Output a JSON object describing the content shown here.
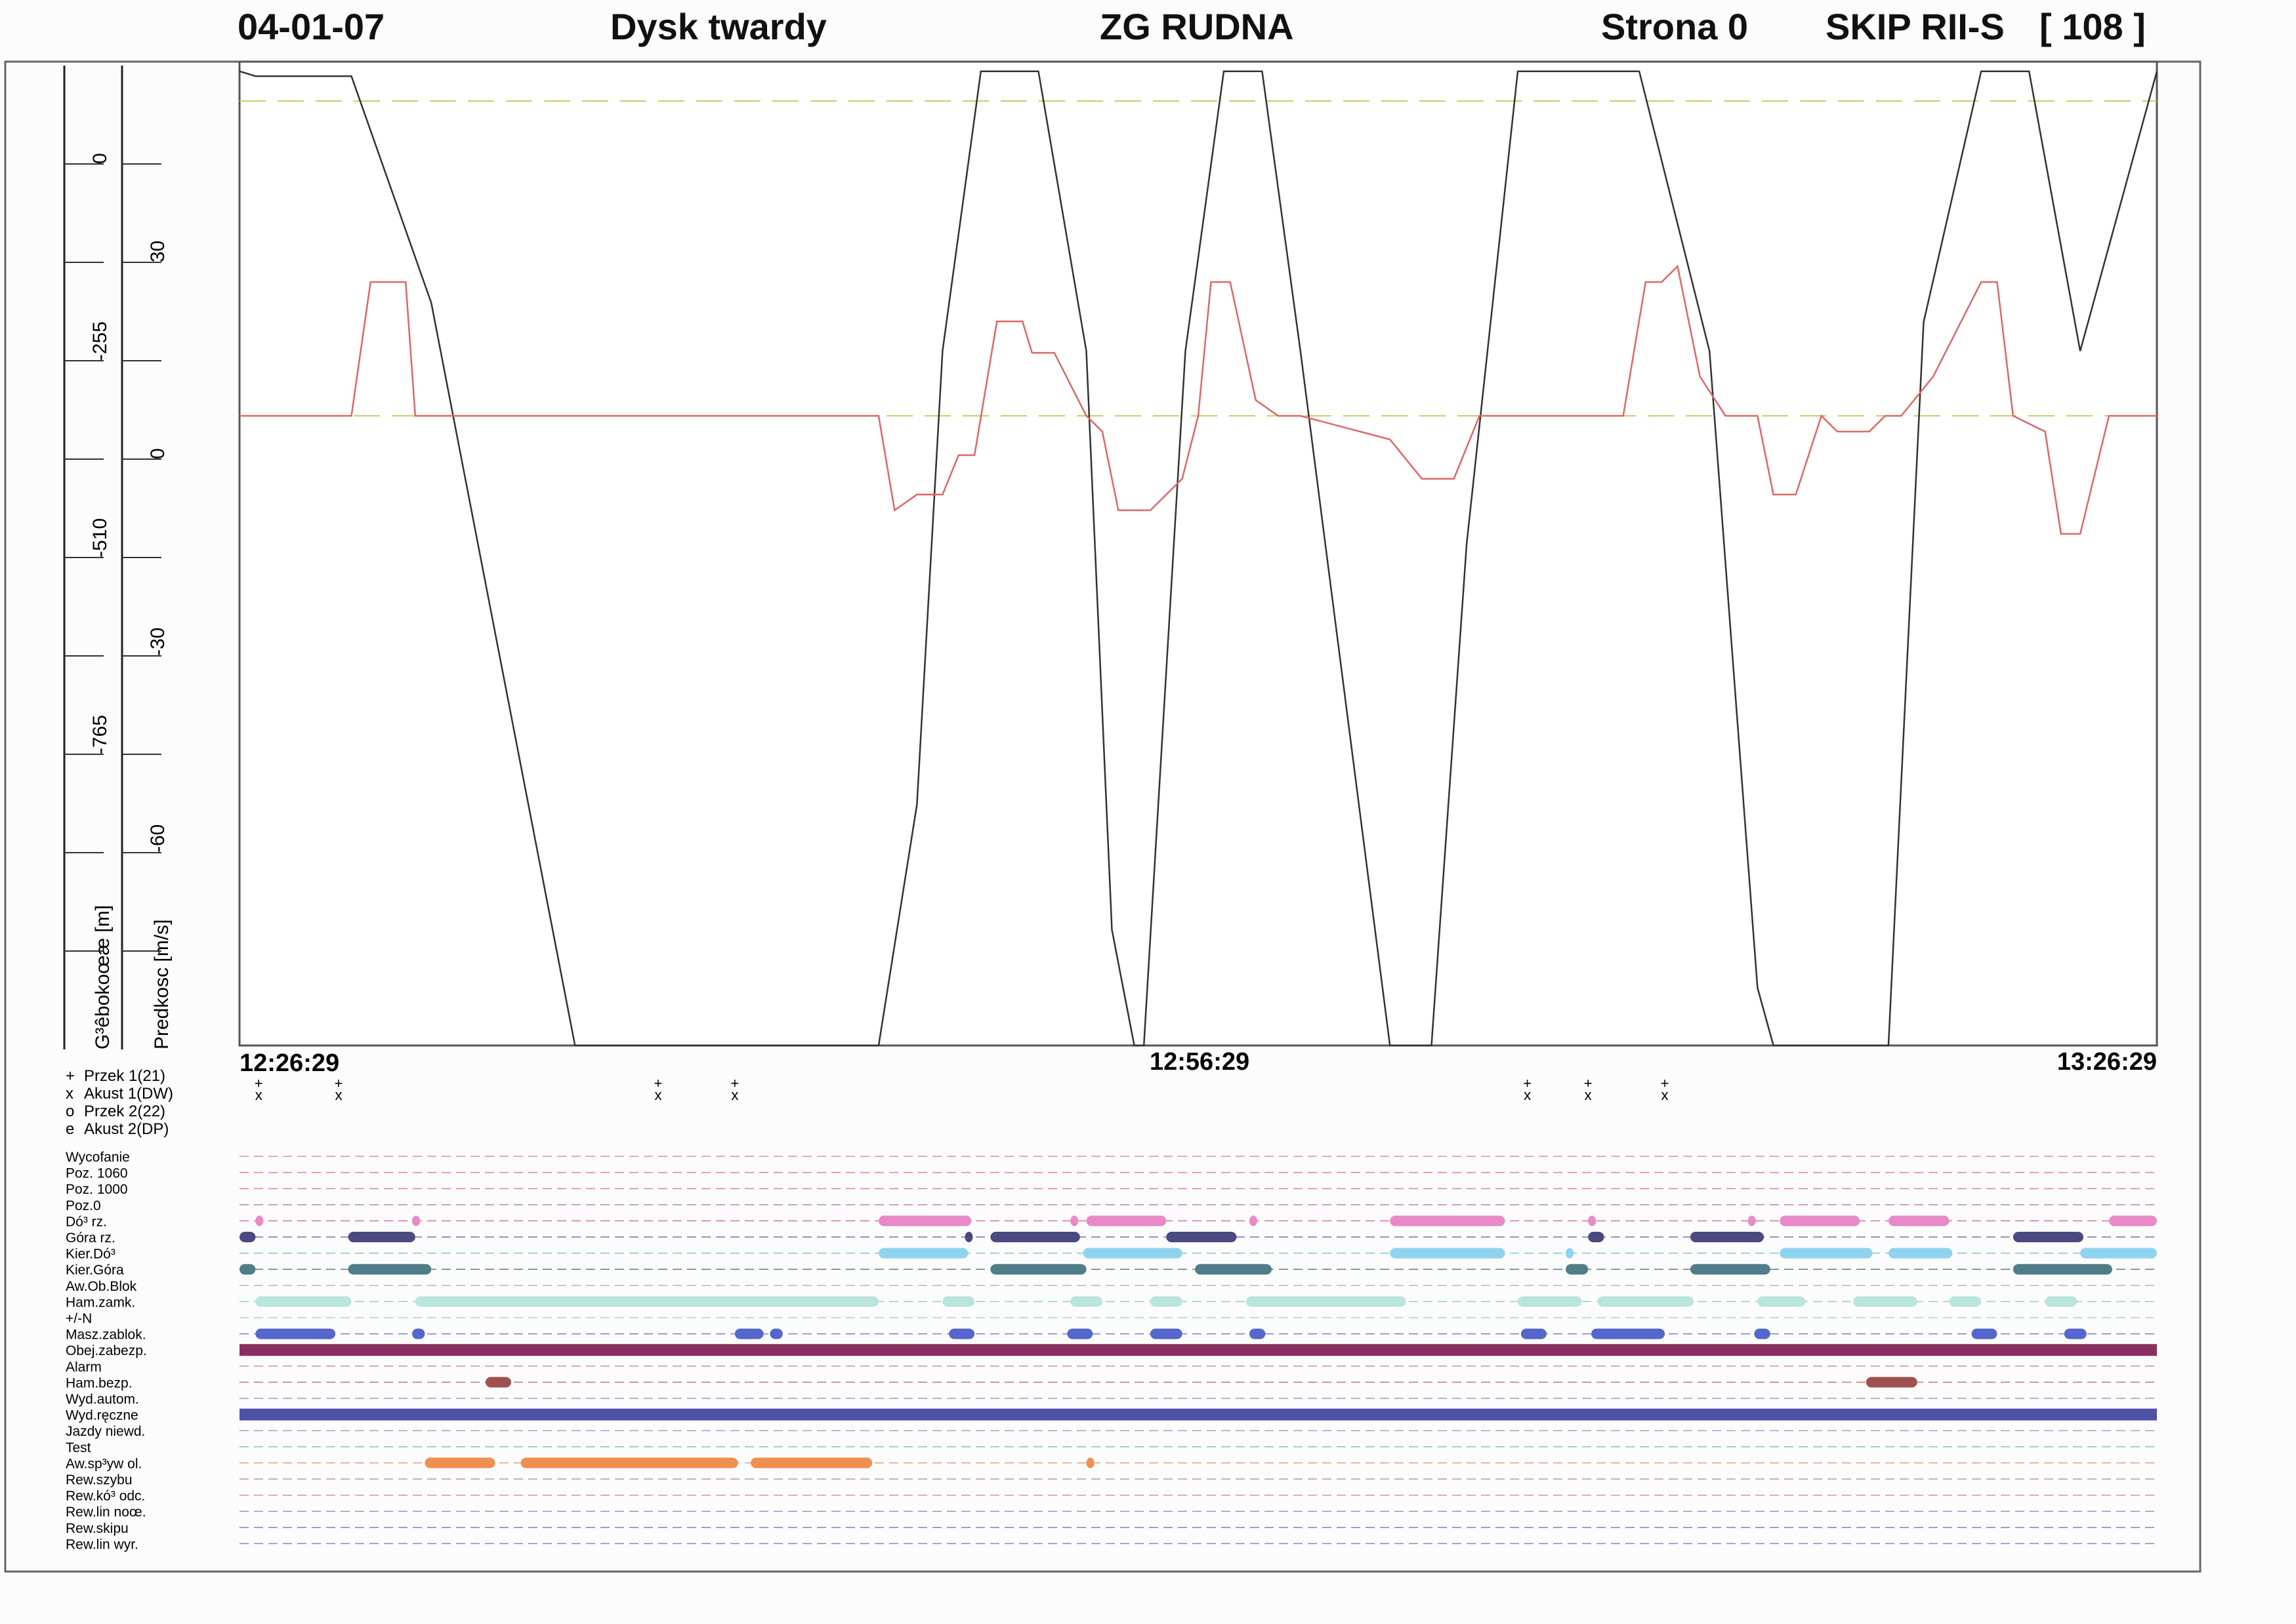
{
  "header": {
    "date": "04-01-07",
    "source": "Dysk twardy",
    "mine": "ZG RUDNA",
    "page": "Strona 0",
    "shaft": "SKIP RII-S",
    "number": "[ 108 ]"
  },
  "axes": {
    "depth": {
      "label": "G³êbokoœæ [m]",
      "ticks": [
        "0",
        "-255",
        "-510",
        "-765"
      ]
    },
    "speed": {
      "label": "Predkosc [m/s]",
      "ticks": [
        "30",
        "0",
        "-30",
        "-60"
      ]
    }
  },
  "time_labels": [
    "12:26:29",
    "12:56:29",
    "13:26:29"
  ],
  "event_legend": [
    {
      "symbol": "+",
      "label": "Przek 1(21)"
    },
    {
      "symbol": "x",
      "label": "Akust 1(DW)"
    },
    {
      "symbol": "o",
      "label": "Przek 2(22)"
    },
    {
      "symbol": "e",
      "label": "Akust 2(DP)"
    }
  ],
  "status_labels": [
    "Wycofanie",
    "Poz. 1060",
    "Poz. 1000",
    "Poz.0",
    "Dó³ rz.",
    "Góra rz.",
    "Kier.Dó³",
    "Kier.Góra",
    "Aw.Ob.Blok",
    "Ham.zamk.",
    "+/-N",
    "Masz.zablok.",
    "Obej.zabezp.",
    "Alarm",
    "Ham.bezp.",
    "Wyd.autom.",
    "Wyd.ręczne",
    "Jazdy niewd.",
    "Test",
    "Aw.sp³yw ol.",
    "Rew.szybu",
    "Rew.kó³ odc.",
    "Rew.lin noœ.",
    "Rew.skipu",
    "Rew.lin wyr."
  ],
  "colors": {
    "depth_line": "#333333",
    "speed_line": "#e06666",
    "reference_line": "#c8cc6a",
    "frame": "#555555"
  },
  "chart_data": {
    "type": "line",
    "x_unit": "minutes from 12:26:29",
    "x_range": [
      0,
      60
    ],
    "series": [
      {
        "name": "G³êbokoœæ [m]",
        "ylim": [
          -1020,
          0
        ],
        "x": [
          0,
          0.5,
          3.5,
          6,
          10.5,
          20,
          21.2,
          22,
          23.2,
          25,
          26.5,
          27.3,
          28,
          28.3,
          29.6,
          30.8,
          32,
          33.2,
          36,
          37.3,
          38.4,
          40,
          41,
          42.5,
          43.8,
          46,
          47.5,
          48,
          51.6,
          52.7,
          54.5,
          56,
          57.6,
          60
        ],
        "y": [
          -10,
          -15,
          -15,
          -250,
          -1020,
          -1020,
          -770,
          -300,
          -10,
          -10,
          -300,
          -900,
          -1020,
          -1020,
          -300,
          -10,
          -10,
          -300,
          -1020,
          -1020,
          -500,
          -10,
          -10,
          -10,
          -10,
          -300,
          -960,
          -1020,
          -1020,
          -270,
          -10,
          -10,
          -300,
          -10
        ]
      },
      {
        "name": "Predkosc [m/s]",
        "ylim": [
          -80,
          45
        ],
        "x": [
          0,
          3.5,
          4.1,
          5.2,
          5.5,
          20,
          20.5,
          21.2,
          22,
          22.5,
          23,
          23.7,
          24.5,
          24.8,
          25.5,
          26.5,
          27,
          27.5,
          28.5,
          29,
          29.5,
          30,
          30.4,
          31,
          31.8,
          32.5,
          33.2,
          36,
          37,
          38,
          38.8,
          40,
          41,
          42.5,
          43.3,
          44,
          44.5,
          45,
          45.7,
          46.5,
          47.5,
          48,
          48.7,
          49.5,
          50,
          51,
          51.5,
          52,
          53,
          54.5,
          55,
          55.5,
          56.5,
          57,
          57.6,
          58.5,
          59,
          59.5,
          60
        ],
        "y": [
          0,
          0,
          17,
          17,
          0,
          0,
          -12,
          -10,
          -10,
          -5,
          -5,
          12,
          12,
          8,
          8,
          0,
          -2,
          -12,
          -12,
          -10,
          -8,
          0,
          17,
          17,
          2,
          0,
          0,
          -3,
          -8,
          -8,
          0,
          0,
          0,
          0,
          0,
          17,
          17,
          19,
          5,
          0,
          0,
          -10,
          -10,
          0,
          -2,
          -2,
          0,
          0,
          5,
          17,
          17,
          0,
          -2,
          -15,
          -15,
          0,
          0,
          0,
          0
        ]
      }
    ],
    "events": [
      {
        "t": 0.6,
        "marks": "+x"
      },
      {
        "t": 3.1,
        "marks": "+x"
      },
      {
        "t": 13.1,
        "marks": "+x"
      },
      {
        "t": 15.5,
        "marks": "+x"
      },
      {
        "t": 40.3,
        "marks": "+x"
      },
      {
        "t": 42.2,
        "marks": "+x"
      },
      {
        "t": 44.6,
        "marks": "+x"
      }
    ],
    "status_bars": [
      {
        "row": 4,
        "color": "#e88ac8",
        "spans": [
          [
            0.5,
            0.7
          ],
          [
            5.4,
            5.6
          ],
          [
            20,
            22.9
          ],
          [
            26,
            26.2
          ],
          [
            26.5,
            29
          ],
          [
            31.6,
            31.8
          ],
          [
            36,
            39.6
          ],
          [
            42.2,
            42.4
          ],
          [
            47.2,
            47.4
          ],
          [
            48.2,
            50.7
          ],
          [
            51.6,
            53.5
          ],
          [
            58.5,
            60
          ]
        ]
      },
      {
        "row": 5,
        "color": "#4a4a80",
        "spans": [
          [
            0,
            0.5
          ],
          [
            3.4,
            5.5
          ],
          [
            22.7,
            22.9
          ],
          [
            23.5,
            26.3
          ],
          [
            29,
            31.2
          ],
          [
            42.2,
            42.7
          ],
          [
            45.4,
            47.7
          ],
          [
            55.5,
            57.7
          ]
        ]
      },
      {
        "row": 6,
        "color": "#8fd4ef",
        "spans": [
          [
            20,
            22.8
          ],
          [
            26.4,
            29.5
          ],
          [
            36,
            39.6
          ],
          [
            41.5,
            41.7
          ],
          [
            48.2,
            51.1
          ],
          [
            51.6,
            53.6
          ],
          [
            57.6,
            60
          ]
        ]
      },
      {
        "row": 7,
        "color": "#4f7d88",
        "spans": [
          [
            0,
            0.5
          ],
          [
            3.4,
            6
          ],
          [
            23.5,
            26.5
          ],
          [
            29.9,
            32.3
          ],
          [
            41.5,
            42.2
          ],
          [
            45.4,
            47.9
          ],
          [
            55.5,
            58.6
          ]
        ]
      },
      {
        "row": 9,
        "color": "#b9e5da",
        "spans": [
          [
            0.5,
            3.5
          ],
          [
            5.5,
            20
          ],
          [
            22,
            23
          ],
          [
            26,
            27
          ],
          [
            28.5,
            29.5
          ],
          [
            31.5,
            36.5
          ],
          [
            40,
            42
          ],
          [
            42.5,
            45.5
          ],
          [
            47.5,
            49
          ],
          [
            50.5,
            52.5
          ],
          [
            53.5,
            54.5
          ],
          [
            56.5,
            57.5
          ]
        ]
      },
      {
        "row": 11,
        "color": "#5566cc",
        "spans": [
          [
            0.5,
            3
          ],
          [
            5.4,
            5.8
          ],
          [
            15.5,
            16.4
          ],
          [
            16.6,
            17
          ],
          [
            22.2,
            23
          ],
          [
            25.9,
            26.7
          ],
          [
            28.5,
            29.5
          ],
          [
            31.6,
            32.1
          ],
          [
            40.1,
            40.9
          ],
          [
            42.3,
            44.6
          ],
          [
            47.4,
            47.9
          ],
          [
            54.2,
            55
          ],
          [
            57.1,
            57.8
          ]
        ]
      },
      {
        "row": 12,
        "color": "#8a3060",
        "spans": [
          [
            0,
            60
          ]
        ]
      },
      {
        "row": 14,
        "color": "#a05050",
        "spans": [
          [
            7.7,
            8.5
          ],
          [
            50.9,
            52.5
          ]
        ]
      },
      {
        "row": 16,
        "color": "#5050a8",
        "spans": [
          [
            0,
            60
          ]
        ]
      },
      {
        "row": 19,
        "color": "#f09050",
        "spans": [
          [
            5.8,
            8
          ],
          [
            8.8,
            15.6
          ],
          [
            16,
            19.8
          ],
          [
            26.5,
            26.7
          ]
        ]
      }
    ]
  }
}
